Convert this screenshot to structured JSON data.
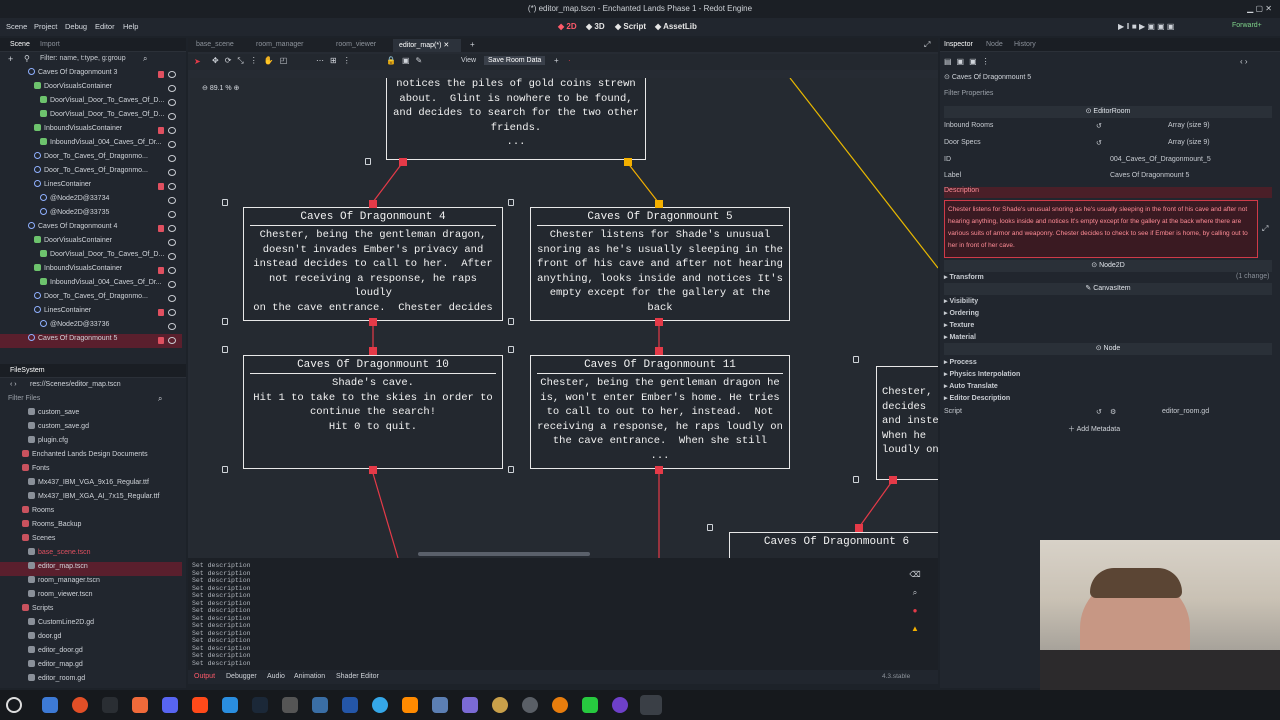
{
  "window": {
    "title": "(*) editor_map.tscn - Enchanted Lands Phase 1 - Redot Engine"
  },
  "menu": [
    "Scene",
    "Project",
    "Debug",
    "Editor",
    "Help"
  ],
  "workspaces": [
    "2D",
    "3D",
    "Script",
    "AssetLib"
  ],
  "renderer": "Forward+",
  "left_tabs": [
    "Scene",
    "Import"
  ],
  "scene_filter_placeholder": "Filter: name, t:type, g:group",
  "scene_tree": [
    "Caves Of Dragonmount 3",
    "DoorVisualsContainer",
    "DoorVisual_Door_To_Caves_Of_D...",
    "DoorVisual_Door_To_Caves_Of_D...",
    "InboundVisualsContainer",
    "InboundVisual_004_Caves_Of_Dr...",
    "Door_To_Caves_Of_Dragonmo...",
    "Door_To_Caves_Of_Dragonmo...",
    "LinesContainer",
    "@Node2D@33734",
    "@Node2D@33735",
    "Caves Of Dragonmount 4",
    "DoorVisualsContainer",
    "DoorVisual_Door_To_Caves_Of_D...",
    "InboundVisualsContainer",
    "InboundVisual_004_Caves_Of_Dr...",
    "Door_To_Caves_Of_Dragonmo...",
    "LinesContainer",
    "@Node2D@33736",
    "Caves Of Dragonmount 5"
  ],
  "filesystem": {
    "title": "FileSystem",
    "path": "res://Scenes/editor_map.tscn",
    "filter_placeholder": "Filter Files",
    "items": [
      "custom_save",
      "custom_save.gd",
      "plugin.cfg",
      "Enchanted Lands Design Documents",
      "Fonts",
      "Mx437_IBM_VGA_9x16_Regular.ttf",
      "Mx437_IBM_XGA_AI_7x15_Regular.ttf",
      "Rooms",
      "Rooms_Backup",
      "Scenes",
      "base_scene.tscn",
      "editor_map.tscn",
      "room_manager.tscn",
      "room_viewer.tscn",
      "Scripts",
      "CustomLine2D.gd",
      "door.gd",
      "editor_door.gd",
      "editor_map.gd",
      "editor_room.gd"
    ]
  },
  "editor_tabs": [
    "base_scene",
    "room_manager",
    "room_viewer",
    "editor_map(*)"
  ],
  "toolbar": {
    "view": "View",
    "save": "Save Room Data",
    "zoom": "89.1 %"
  },
  "map_nodes": [
    {
      "title": "",
      "desc": "notices the piles of gold coins strewn\nabout.  Glint is nowhere to be found,\nand decides to search for the two other\nfriends.\n..."
    },
    {
      "title": "Caves Of Dragonmount 4",
      "desc": "Chester, being the gentleman dragon,\ndoesn't invades Ember's privacy and\ninstead decides to call to her.  After\nnot receiving a response, he raps loudly\non the cave entrance.  Chester decides\n..."
    },
    {
      "title": "Caves Of Dragonmount 5",
      "desc": "Chester listens for Shade's unusual\nsnoring as he's usually sleeping in the\nfront of his cave and after not hearing\nanything, looks inside and notices It's\nempty except for the gallery at the back\n..."
    },
    {
      "title": "Caves Of Dragonmount 10",
      "desc": "Shade's cave.\nHit 1 to take to the skies in order to\ncontinue the search!\nHit 0 to quit."
    },
    {
      "title": "Caves Of Dragonmount 11",
      "desc": "Chester, being the gentleman dragon he\nis, won't enter Ember's home. He tries\nto call to out to her, instead.  Not\nreceiving a response, he raps loudly on\nthe cave entrance.  When she still\n..."
    },
    {
      "title": "",
      "desc": "Chester,\ndecides\nand inste\nWhen he\nloudly on"
    },
    {
      "title": "Caves Of Dragonmount 6",
      "desc": ""
    }
  ],
  "output_lines": [
    "Set description",
    "Set description",
    "Set description",
    "Set description",
    "Set description",
    "Set description",
    "Set description",
    "Set description",
    "Set description",
    "Set description",
    "Set description",
    "Set description",
    "Set description",
    "Set description"
  ],
  "bottom_tabs": [
    "Output",
    "Debugger",
    "Audio",
    "Animation",
    "Shader Editor"
  ],
  "version": "4.3.stable",
  "inspector": {
    "tabs": [
      "Inspector",
      "Node",
      "History"
    ],
    "object": "Caves Of Dragonmount 5",
    "filter_placeholder": "Filter Properties",
    "class": "EditorRoom",
    "props": [
      {
        "k": "Inbound Rooms",
        "v": "Array (size 9)"
      },
      {
        "k": "Door Specs",
        "v": "Array (size 9)"
      },
      {
        "k": "ID",
        "v": "004_Caves_Of_Dragonmount_5"
      },
      {
        "k": "Label",
        "v": "Caves Of Dragonmount 5"
      }
    ],
    "desc_label": "Description",
    "description": "Chester listens for Shade's unusual snoring as he's usually sleeping in the front of his cave and after not hearing anything, looks inside and notices It's empty except for the gallery at the back where there are various suits of armor and weaponry.  Chester decides to check to see if Ember is home, by calling out to her in front of her cave.",
    "node2d": "Node2D",
    "transform": "Transform",
    "transform_note": "(1 change)",
    "canvas_item": "CanvasItem",
    "canvas_sections": [
      "Visibility",
      "Ordering",
      "Texture",
      "Material"
    ],
    "node": "Node",
    "node_sections": [
      "Process",
      "Physics Interpolation",
      "Auto Translate",
      "Editor Description"
    ],
    "script_label": "Script",
    "script_value": "editor_room.gd",
    "add_metadata": "Add Metadata"
  },
  "colors": {
    "accent": "#e53a48",
    "yellow": "#f4b000",
    "bg": "#252a31"
  }
}
